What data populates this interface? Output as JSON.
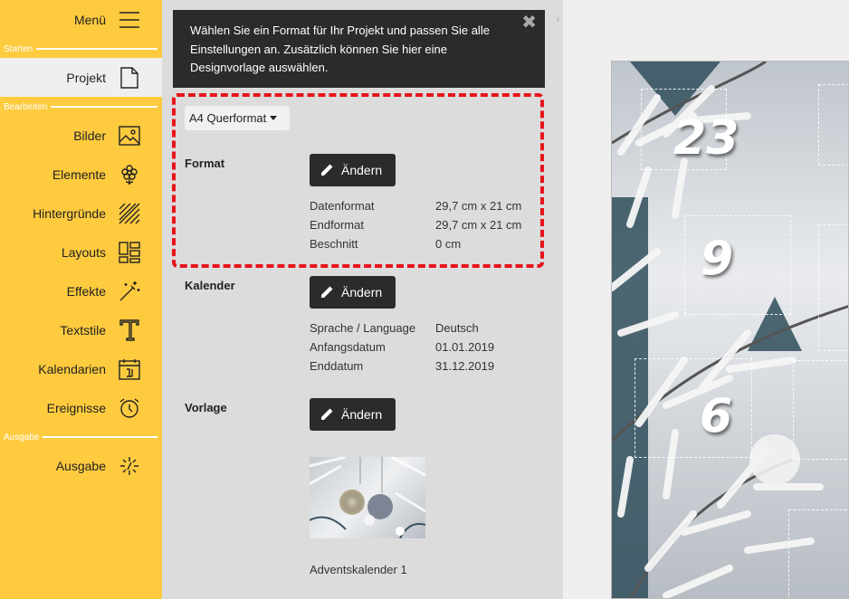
{
  "sidebar": {
    "menu": {
      "label": "Menü",
      "icon": "hamburger-icon"
    },
    "sections": {
      "start": "Starten",
      "edit": "Bearbeiten",
      "output": "Ausgabe"
    },
    "items": [
      {
        "label": "Projekt",
        "icon": "page-icon",
        "active": true
      },
      {
        "label": "Bilder",
        "icon": "image-icon"
      },
      {
        "label": "Elemente",
        "icon": "flower-icon"
      },
      {
        "label": "Hintergründe",
        "icon": "hatch-pattern-icon"
      },
      {
        "label": "Layouts",
        "icon": "layout-grid-icon"
      },
      {
        "label": "Effekte",
        "icon": "magic-wand-icon"
      },
      {
        "label": "Textstile",
        "icon": "text-t-icon"
      },
      {
        "label": "Kalendarien",
        "icon": "calendar-icon"
      },
      {
        "label": "Ereignisse",
        "icon": "alarm-clock-icon"
      },
      {
        "label": "Ausgabe",
        "icon": "sparkle-output-icon"
      }
    ]
  },
  "tip": {
    "text": "Wählen Sie ein Format für Ihr Projekt und passen Sie alle Einstellungen an. Zusätzlich können Sie hier eine Designvorlage auswählen.",
    "close": "✖"
  },
  "format_select": {
    "value": "A4 Querformat"
  },
  "format": {
    "title": "Format",
    "button": "Ändern",
    "rows": [
      {
        "k": "Datenformat",
        "v": "29,7 cm x 21 cm"
      },
      {
        "k": "Endformat",
        "v": "29,7 cm x 21 cm"
      },
      {
        "k": "Beschnitt",
        "v": "0 cm"
      }
    ]
  },
  "calendar": {
    "title": "Kalender",
    "button": "Ändern",
    "rows": [
      {
        "k": "Sprache / Language",
        "v": "Deutsch"
      },
      {
        "k": "Anfangsdatum",
        "v": "01.01.2019"
      },
      {
        "k": "Enddatum",
        "v": "31.12.2019"
      }
    ]
  },
  "template": {
    "title": "Vorlage",
    "button": "Ändern",
    "caption": "Adventskalender 1"
  },
  "canvas": {
    "numbers": [
      "23",
      "9",
      "6"
    ]
  },
  "colors": {
    "sidebar": "#fecb3f",
    "panel": "#dcdcdc",
    "dark": "#2b2b2b",
    "highlight": "#e8131b"
  }
}
